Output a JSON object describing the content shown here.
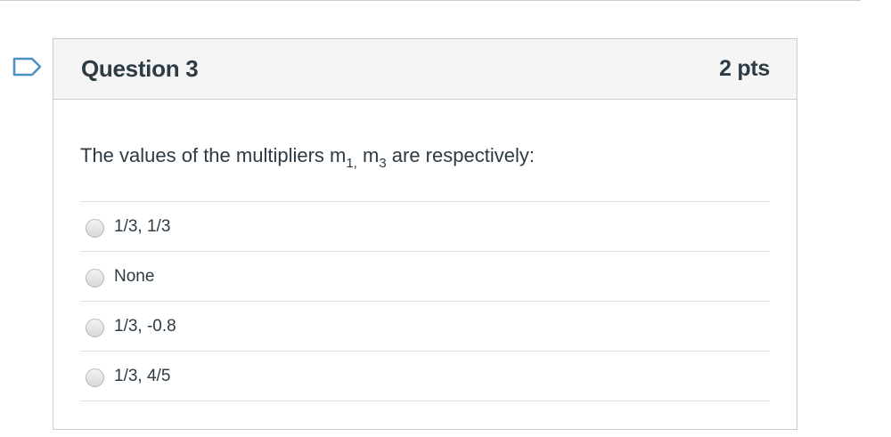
{
  "question": {
    "title": "Question 3",
    "points": "2 pts",
    "text_before": "The values of the multipliers m",
    "sub_1": "1,",
    "text_middle": " m",
    "sub_2": "3",
    "text_after": " are respectively:",
    "answers": [
      {
        "label": "1/3, 1/3",
        "selected": false
      },
      {
        "label": "None",
        "selected": false
      },
      {
        "label": "1/3, -0.8",
        "selected": false
      },
      {
        "label": "1/3, 4/5",
        "selected": false
      }
    ]
  },
  "icons": {
    "flag": "flag-outline-icon"
  },
  "colors": {
    "text": "#2d3b45",
    "border": "#c7cdd1",
    "header_bg": "#f5f5f5",
    "flag": "#4a90c2"
  }
}
